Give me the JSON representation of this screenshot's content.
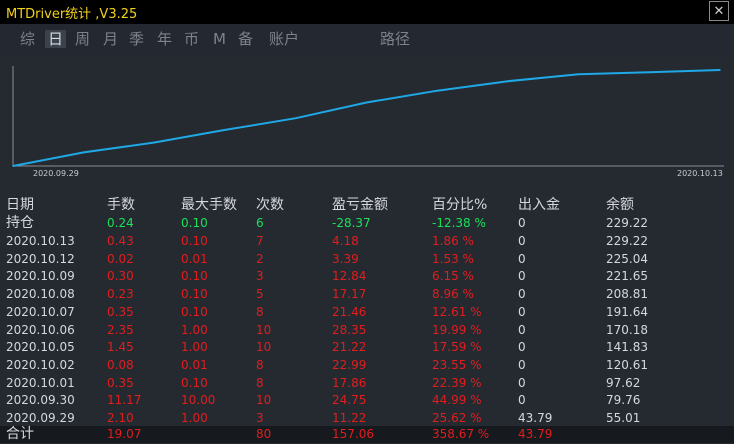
{
  "title": "MTDriver统计 ,V3.25",
  "close_label": "✕",
  "tabs": [
    "综",
    "日",
    "周",
    "月",
    "季",
    "年",
    "币",
    "M",
    "备",
    "账户",
    "路径"
  ],
  "active_tab": "日",
  "colors": {
    "line": "#1fa8e6",
    "positive": "#19e15a",
    "negative": "#e21d1d",
    "text": "#d5d8dc"
  },
  "chart_data": {
    "type": "line",
    "x": [
      "2020.09.29",
      "2020.09.30",
      "2020.10.01",
      "2020.10.02",
      "2020.10.05",
      "2020.10.06",
      "2020.10.07",
      "2020.10.08",
      "2020.10.09",
      "2020.10.12",
      "2020.10.13"
    ],
    "series": [
      {
        "values": [
          55.01,
          79.76,
          97.62,
          120.61,
          141.83,
          170.18,
          191.64,
          208.81,
          221.65,
          225.04,
          229.22
        ]
      }
    ],
    "x_start_label": "2020.09.29",
    "x_end_label": "2020.10.13",
    "ylim": [
      55.01,
      229.22
    ],
    "grid": false
  },
  "table": {
    "headers": [
      "日期",
      "手数",
      "最大手数",
      "次数",
      "盈亏金额",
      "百分比%",
      "出入金",
      "余额"
    ],
    "holding": {
      "label": "持仓",
      "lots": "0.24",
      "max_lots": "0.10",
      "count": "6",
      "pnl": "-28.37",
      "pct": "-12.38 %",
      "cash": "0",
      "balance": "229.22"
    },
    "rows": [
      {
        "date": "2020.10.13",
        "lots": "0.43",
        "max_lots": "0.10",
        "count": "7",
        "pnl": "4.18",
        "pct": "1.86 %",
        "cash": "0",
        "balance": "229.22"
      },
      {
        "date": "2020.10.12",
        "lots": "0.02",
        "max_lots": "0.01",
        "count": "2",
        "pnl": "3.39",
        "pct": "1.53 %",
        "cash": "0",
        "balance": "225.04"
      },
      {
        "date": "2020.10.09",
        "lots": "0.30",
        "max_lots": "0.10",
        "count": "3",
        "pnl": "12.84",
        "pct": "6.15 %",
        "cash": "0",
        "balance": "221.65"
      },
      {
        "date": "2020.10.08",
        "lots": "0.23",
        "max_lots": "0.10",
        "count": "5",
        "pnl": "17.17",
        "pct": "8.96 %",
        "cash": "0",
        "balance": "208.81"
      },
      {
        "date": "2020.10.07",
        "lots": "0.35",
        "max_lots": "0.10",
        "count": "8",
        "pnl": "21.46",
        "pct": "12.61 %",
        "cash": "0",
        "balance": "191.64"
      },
      {
        "date": "2020.10.06",
        "lots": "2.35",
        "max_lots": "1.00",
        "count": "10",
        "pnl": "28.35",
        "pct": "19.99 %",
        "cash": "0",
        "balance": "170.18"
      },
      {
        "date": "2020.10.05",
        "lots": "1.45",
        "max_lots": "1.00",
        "count": "10",
        "pnl": "21.22",
        "pct": "17.59 %",
        "cash": "0",
        "balance": "141.83"
      },
      {
        "date": "2020.10.02",
        "lots": "0.08",
        "max_lots": "0.01",
        "count": "8",
        "pnl": "22.99",
        "pct": "23.55 %",
        "cash": "0",
        "balance": "120.61"
      },
      {
        "date": "2020.10.01",
        "lots": "0.35",
        "max_lots": "0.10",
        "count": "8",
        "pnl": "17.86",
        "pct": "22.39 %",
        "cash": "0",
        "balance": "97.62"
      },
      {
        "date": "2020.09.30",
        "lots": "11.17",
        "max_lots": "10.00",
        "count": "10",
        "pnl": "24.75",
        "pct": "44.99 %",
        "cash": "0",
        "balance": "79.76"
      },
      {
        "date": "2020.09.29",
        "lots": "2.10",
        "max_lots": "1.00",
        "count": "3",
        "pnl": "11.22",
        "pct": "25.62 %",
        "cash": "43.79",
        "balance": "55.01"
      }
    ],
    "total": {
      "label": "合计",
      "lots": "19.07",
      "count": "80",
      "pnl": "157.06",
      "pct": "358.67 %",
      "cash": "43.79"
    }
  }
}
